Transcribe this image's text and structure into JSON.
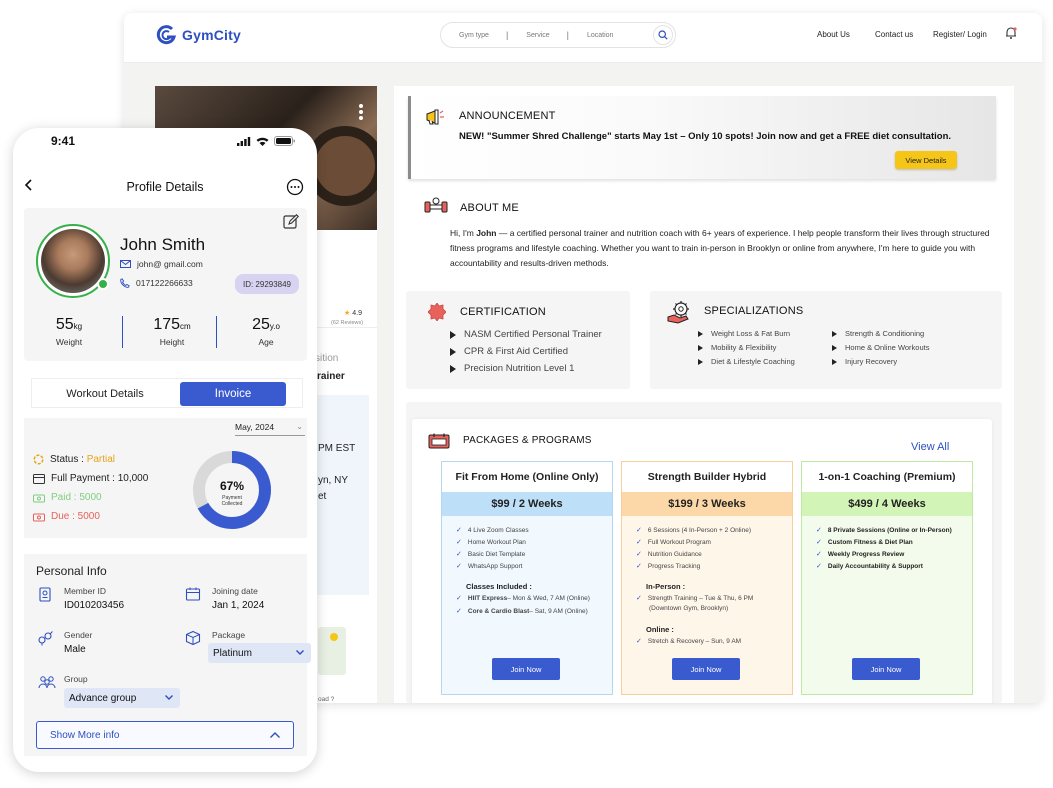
{
  "desktop": {
    "brand": "GymCity",
    "search": {
      "type": "Gym type",
      "service": "Service",
      "location": "Location"
    },
    "nav": {
      "about": "About Us",
      "contact": "Contact us",
      "register": "Register/ Login"
    },
    "left_fragments": {
      "rating": "4.9",
      "reviews": "(62 Reviews)",
      "position": "sition",
      "trainer": "rainer",
      "time": "PM EST",
      "city": "yn, NY",
      "et": "et",
      "road": "oad ?"
    },
    "announcement": {
      "title": "ANNOUNCEMENT",
      "text": "NEW! \"Summer Shred Challenge\" starts May 1st – Only 10 spots! Join now and get a FREE diet consultation.",
      "button": "View Details"
    },
    "about": {
      "title": "ABOUT ME",
      "prefix": "Hi, I'm ",
      "name": "John",
      "text": " — a certified personal trainer and nutrition coach with 6+ years of experience. I help people transform their lives through structured fitness programs and lifestyle coaching. Whether you want to train in-person in Brooklyn or online from anywhere, I'm here to guide you with accountability and results-driven methods."
    },
    "certification": {
      "title": "CERTIFICATION",
      "items": [
        "NASM Certified Personal Trainer",
        "CPR & First Aid Certified",
        "Precision Nutrition Level 1"
      ]
    },
    "specializations": {
      "title": "SPECIALIZATIONS",
      "col1": [
        "Weight Loss & Fat Burn",
        "Mobility & Flexibility",
        "Diet & Lifestyle Coaching"
      ],
      "col2": [
        "Strength & Conditioning",
        "Home & Online Workouts",
        "Injury Recovery"
      ]
    },
    "packages": {
      "title": "PACKAGES & PROGRAMS",
      "view_all": "View All",
      "join": "Join Now",
      "items": [
        {
          "name": "Fit From Home (Online Only)",
          "price": "$99 / 2 Weeks",
          "features": [
            "4 Live Zoom Classes",
            "Home Workout Plan",
            "Basic Diet Template",
            "WhatsApp Support"
          ],
          "section": "Classes Included :",
          "section_items": [
            {
              "bold": "HIIT Express",
              "rest": " – Mon & Wed, 7 AM (Online)"
            },
            {
              "bold": "Core & Cardio Blast",
              "rest": " – Sat, 9 AM (Online)"
            }
          ]
        },
        {
          "name": "Strength Builder Hybrid",
          "price": "$199 / 3 Weeks",
          "features": [
            "6 Sessions (4 In-Person + 2 Online)",
            "Full Workout Program",
            "Nutrition Guidance",
            "Progress Tracking"
          ],
          "section": "In-Person :",
          "section_items": [
            "Strength Training – Tue & Thu, 6 PM",
            "(Downtown Gym, Brooklyn)"
          ],
          "section2": "Online :",
          "section2_items": [
            "Stretch & Recovery – Sun, 9 AM"
          ]
        },
        {
          "name": "1-on-1 Coaching (Premium)",
          "price": "$499 / 4 Weeks",
          "features": [
            "8 Private Sessions (Online or In-Person)",
            "Custom Fitness & Diet Plan",
            "Weekly Progress Review",
            "Daily Accountability & Support"
          ]
        }
      ]
    }
  },
  "phone": {
    "time": "9:41",
    "title": "Profile Details",
    "profile": {
      "name": "John Smith",
      "email": "john@ gmail.com",
      "phone": "017122266633",
      "id": "ID: 29293849",
      "stats": [
        {
          "value": "55",
          "unit": "kg",
          "label": "Weight"
        },
        {
          "value": "175",
          "unit": "cm",
          "label": "Height"
        },
        {
          "value": "25",
          "unit": "y.o",
          "label": "Age"
        }
      ]
    },
    "tabs": {
      "workout": "Workout Details",
      "invoice": "Invoice"
    },
    "invoice": {
      "month": "May, 2024",
      "status_label": "Status : ",
      "status_value": "Partial",
      "full_payment": "Full Payment : 10,000",
      "paid": "Paid : 5000",
      "due": "Due : 5000",
      "percent": 67,
      "percent_text": "67%",
      "donut_caption1": "Payment",
      "donut_caption2": "Collected"
    },
    "personal": {
      "title": "Personal Info",
      "member_id_label": "Member ID",
      "member_id": "ID010203456",
      "joining_label": "Joining date",
      "joining": "Jan 1, 2024",
      "gender_label": "Gender",
      "gender": "Male",
      "package_label": "Package",
      "package": "Platinum",
      "group_label": "Group",
      "group": "Advance group",
      "show_more": "Show More info"
    }
  },
  "colors": {
    "brand": "#2d4fc1",
    "button": "#3a5bd0",
    "yellow": "#f5c518",
    "green": "#37b04a",
    "status": "#e8a317",
    "paid": "#7fcf7f",
    "due": "#e8615a",
    "pkg1_head": "#bddff7",
    "pkg2_head": "#fcd8a8",
    "pkg3_head": "#d2f4b6"
  }
}
